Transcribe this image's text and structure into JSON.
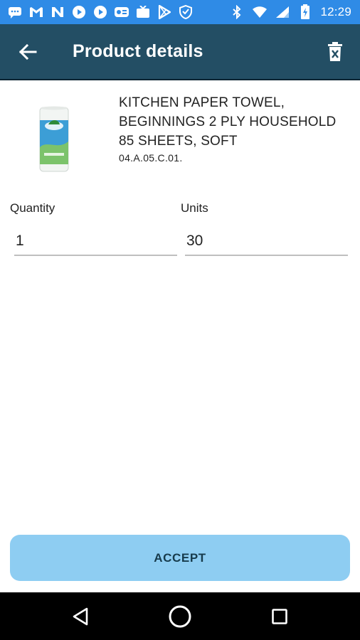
{
  "status_bar": {
    "time": "12:29",
    "left_icons": [
      "message-icon",
      "gmail-icon",
      "n-app-icon",
      "play-circle-icon",
      "play-circle-icon",
      "media-icon",
      "tv-icon",
      "play-store-icon",
      "shield-icon"
    ],
    "right_icons": [
      "bluetooth-icon",
      "wifi-icon",
      "cell-signal-icon",
      "battery-icon"
    ]
  },
  "app_bar": {
    "title": "Product details",
    "background": "#234e64"
  },
  "product": {
    "name": "KITCHEN PAPER TOWEL, BEGINNINGS 2 PLY HOUSEHOLD 85 SHEETS, SOFT",
    "code": "04.A.05.C.01."
  },
  "fields": {
    "quantity": {
      "label": "Quantity",
      "value": "1"
    },
    "units": {
      "label": "Units",
      "value": "30"
    }
  },
  "actions": {
    "accept_label": "ACCEPT",
    "accept_color": "#8ecdf2"
  },
  "nav_bar": {
    "icons": [
      "back-triangle-icon",
      "home-circle-icon",
      "recents-square-icon"
    ]
  }
}
